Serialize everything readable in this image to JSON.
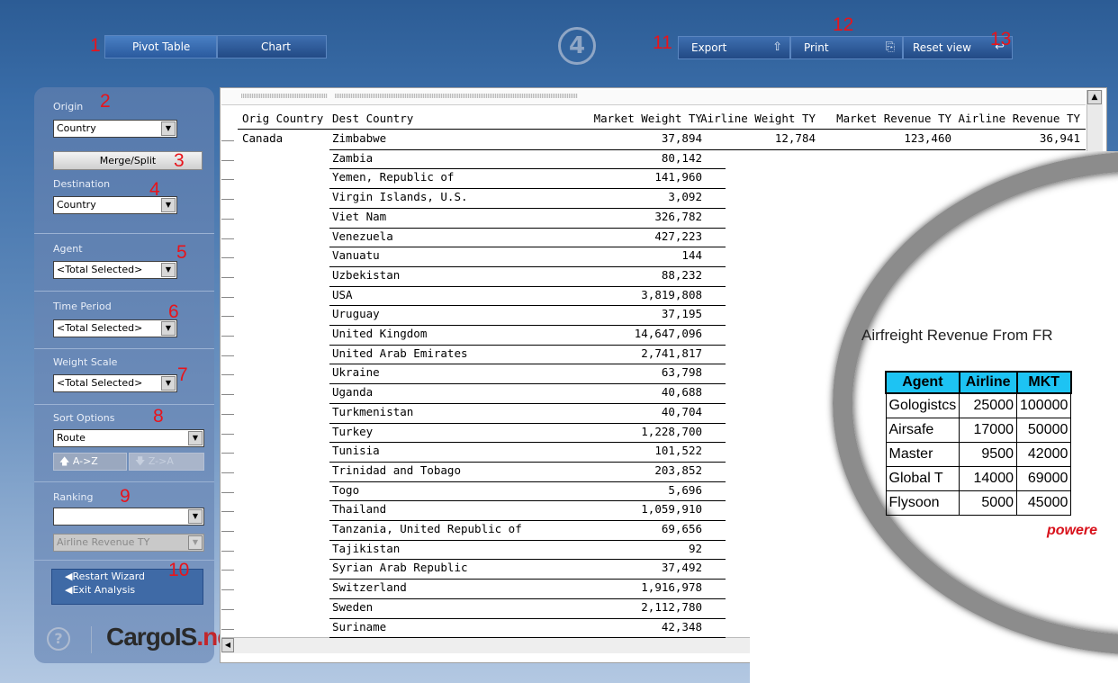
{
  "callouts": {
    "c1": "1",
    "c2": "2",
    "c3": "3",
    "c4": "4",
    "c5": "5",
    "c6": "6",
    "c7": "7",
    "c8": "8",
    "c9": "9",
    "c10": "10",
    "c11": "11",
    "c12": "12",
    "c13": "13"
  },
  "tabs": {
    "pivot": "Pivot Table",
    "chart": "Chart"
  },
  "toolbar": {
    "export": "Export",
    "print": "Print",
    "reset": "Reset view",
    "step": "4"
  },
  "panel": {
    "origin_label": "Origin",
    "origin_value": "Country",
    "merge_split": "Merge/Split",
    "destination_label": "Destination",
    "destination_value": "Country",
    "agent_label": "Agent",
    "agent_value": "<Total Selected>",
    "time_label": "Time Period",
    "time_value": "<Total Selected>",
    "weight_label": "Weight Scale",
    "weight_value": "<Total Selected>",
    "sort_label": "Sort Options",
    "sort_value": "Route",
    "sort_asc": "A->Z",
    "sort_desc": "Z->A",
    "ranking_label": "Ranking",
    "ranking_value": "",
    "ranking_measure": "Airline Revenue TY",
    "restart": "Restart Wizard",
    "exit": "Exit Analysis"
  },
  "brand": {
    "main": "CargoIS",
    "suffix": ".net",
    "help": "?"
  },
  "grid": {
    "headers": [
      "Orig Country",
      "Dest Country",
      "Market Weight TY",
      "Airline Weight TY",
      "Market Revenue TY",
      "Airline Revenue TY"
    ],
    "orig": "Canada",
    "first_row_extra": [
      "12,784",
      "123,460",
      "36,941"
    ],
    "rows": [
      [
        "Zimbabwe",
        "37,894"
      ],
      [
        "Zambia",
        "80,142"
      ],
      [
        "Yemen, Republic of",
        "141,960"
      ],
      [
        "Virgin Islands, U.S.",
        "3,092"
      ],
      [
        "Viet Nam",
        "326,782"
      ],
      [
        "Venezuela",
        "427,223"
      ],
      [
        "Vanuatu",
        "144"
      ],
      [
        "Uzbekistan",
        "88,232"
      ],
      [
        "USA",
        "3,819,808"
      ],
      [
        "Uruguay",
        "37,195"
      ],
      [
        "United Kingdom",
        "14,647,096"
      ],
      [
        "United Arab Emirates",
        "2,741,817"
      ],
      [
        "Ukraine",
        "63,798"
      ],
      [
        "Uganda",
        "40,688"
      ],
      [
        "Turkmenistan",
        "40,704"
      ],
      [
        "Turkey",
        "1,228,700"
      ],
      [
        "Tunisia",
        "101,522"
      ],
      [
        "Trinidad and Tobago",
        "203,852"
      ],
      [
        "Togo",
        "5,696"
      ],
      [
        "Thailand",
        "1,059,910"
      ],
      [
        "Tanzania, United Republic of",
        "69,656"
      ],
      [
        "Tajikistan",
        "92"
      ],
      [
        "Syrian Arab Republic",
        "37,492"
      ],
      [
        "Switzerland",
        "1,916,978"
      ],
      [
        "Sweden",
        "2,112,780"
      ],
      [
        "Suriname",
        "42,348"
      ]
    ]
  },
  "zoom": {
    "title": "Airfreight Revenue From FR",
    "headers": [
      "Agent",
      "Airline",
      "MKT"
    ],
    "rows": [
      [
        "Gologistcs",
        "25000",
        "100000"
      ],
      [
        "Airsafe",
        "17000",
        "50000"
      ],
      [
        "Master",
        "9500",
        "42000"
      ],
      [
        "Global T",
        "14000",
        "69000"
      ],
      [
        "Flysoon",
        "5000",
        "45000"
      ]
    ],
    "powered": "powere"
  }
}
